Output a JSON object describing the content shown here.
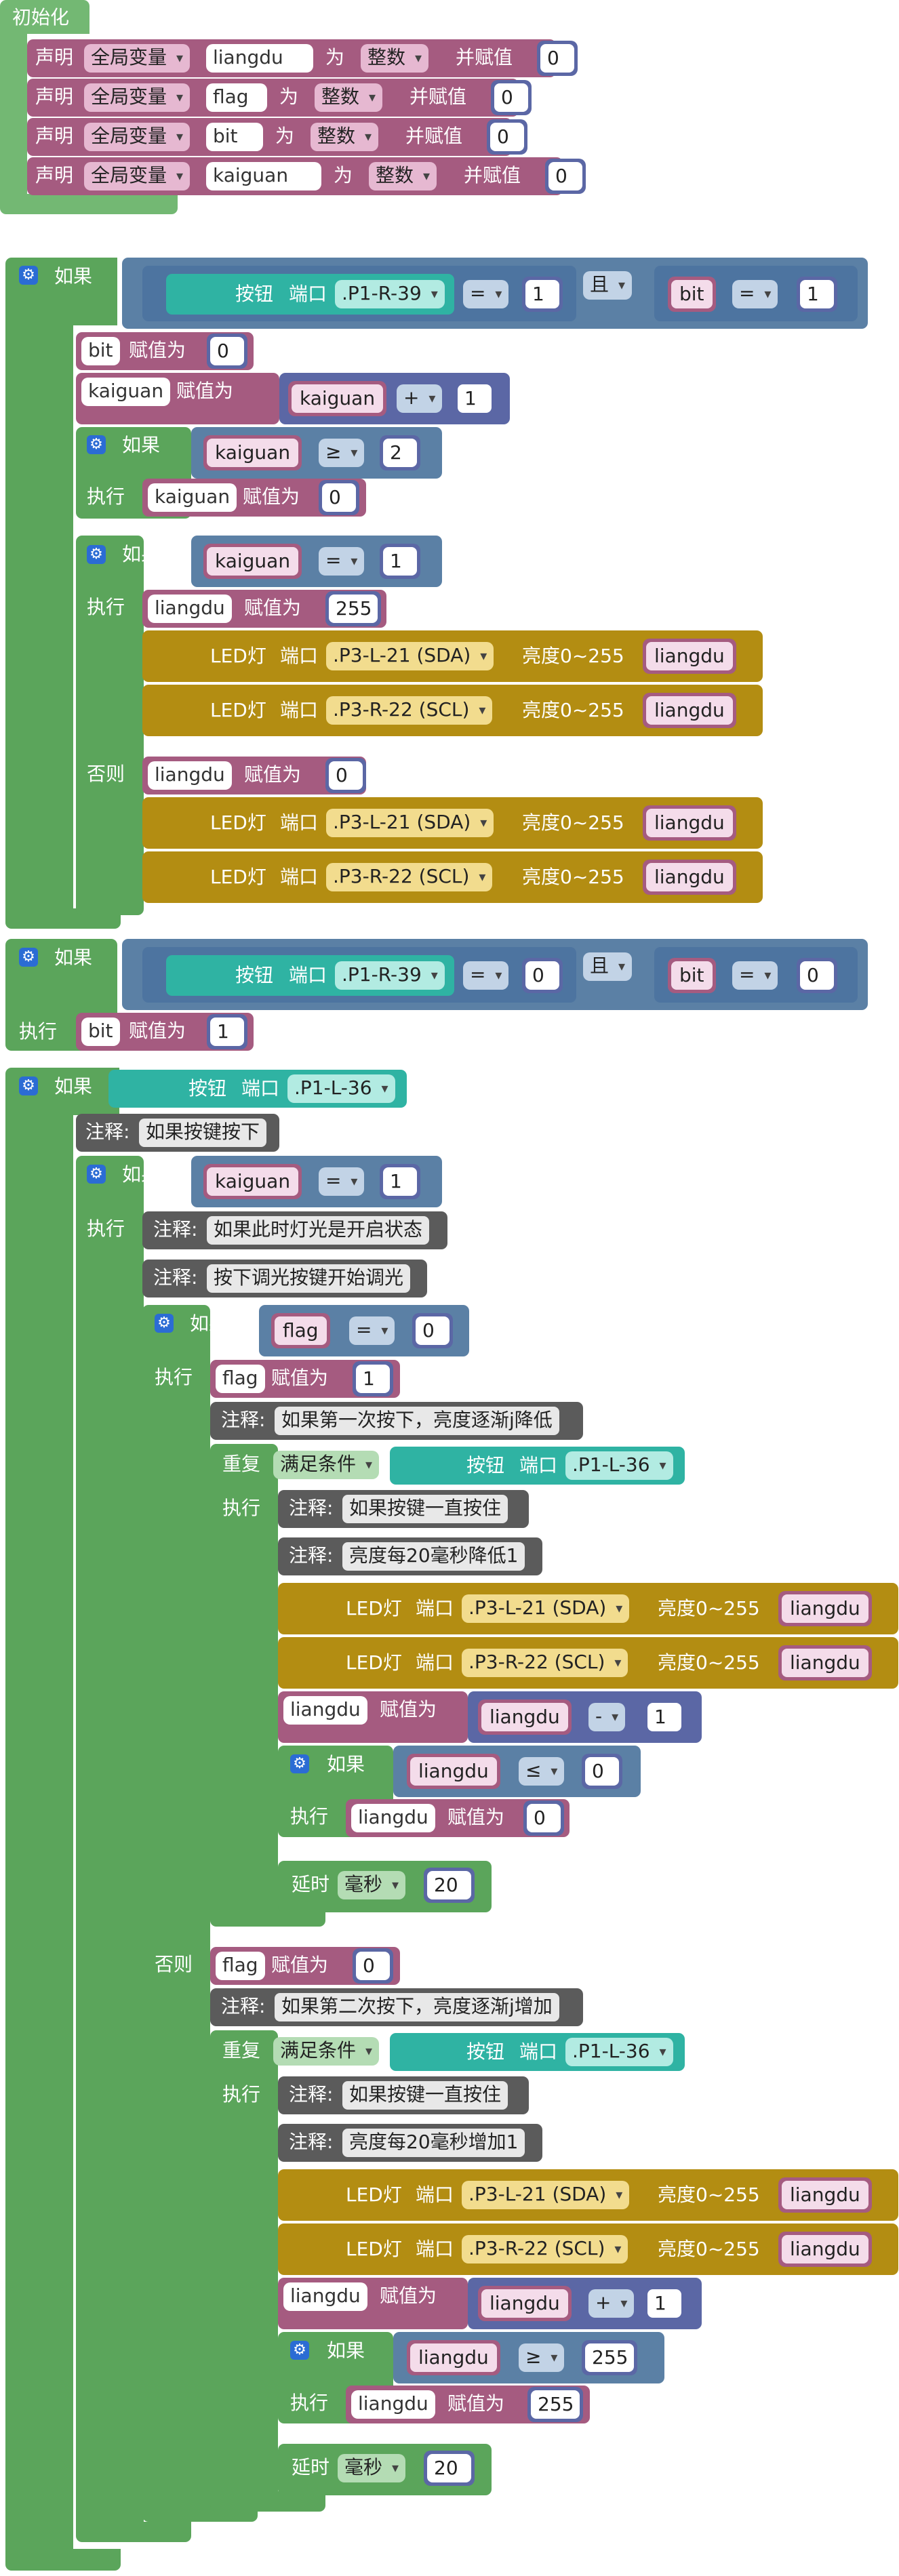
{
  "init": {
    "title": "初始化",
    "declarations": [
      {
        "declare": "声明",
        "scope": "全局变量",
        "name": "liangdu",
        "as": "为",
        "type": "整数",
        "assign": "并赋值",
        "value": "0"
      },
      {
        "declare": "声明",
        "scope": "全局变量",
        "name": "flag",
        "as": "为",
        "type": "整数",
        "assign": "并赋值",
        "value": "0"
      },
      {
        "declare": "声明",
        "scope": "全局变量",
        "name": "bit",
        "as": "为",
        "type": "整数",
        "assign": "并赋值",
        "value": "0"
      },
      {
        "declare": "声明",
        "scope": "全局变量",
        "name": "kaiguan",
        "as": "为",
        "type": "整数",
        "assign": "并赋值",
        "value": "0"
      }
    ]
  },
  "labels": {
    "if": "如果",
    "do": "执行",
    "else": "否则",
    "and": "且",
    "assign": "赋值为",
    "button": "按钮",
    "port": "端口",
    "led": "LED灯",
    "brightness": "亮度0~255",
    "comment": "注释:",
    "repeat": "重复",
    "while": "满足条件",
    "delay": "延时",
    "ms": "毫秒"
  },
  "ops": {
    "eq": "=",
    "ge": "≥",
    "le": "≤",
    "plus": "+",
    "minus": "-"
  },
  "ports": {
    "p1r39": ".P1-R-39",
    "p1l36": ".P1-L-36",
    "p3l21": ".P3-L-21 (SDA)",
    "p3r22": ".P3-R-22 (SCL)"
  },
  "vars": {
    "liangdu": "liangdu",
    "flag": "flag",
    "bit": "bit",
    "kaiguan": "kaiguan"
  },
  "nums": {
    "n0": "0",
    "n1": "1",
    "n2": "2",
    "n20": "20",
    "n255": "255"
  },
  "comments": {
    "c1": "如果按键按下",
    "c2": "如果此时灯光是开启状态",
    "c3": "按下调光按键开始调光",
    "c4": "如果第一次按下，亮度逐渐j降低",
    "c5": "如果按键一直按住",
    "c6": "亮度每20毫秒降低1",
    "c7": "如果第二次按下，亮度逐渐j增加",
    "c8": "如果按键一直按住",
    "c9": "亮度每20毫秒增加1"
  }
}
